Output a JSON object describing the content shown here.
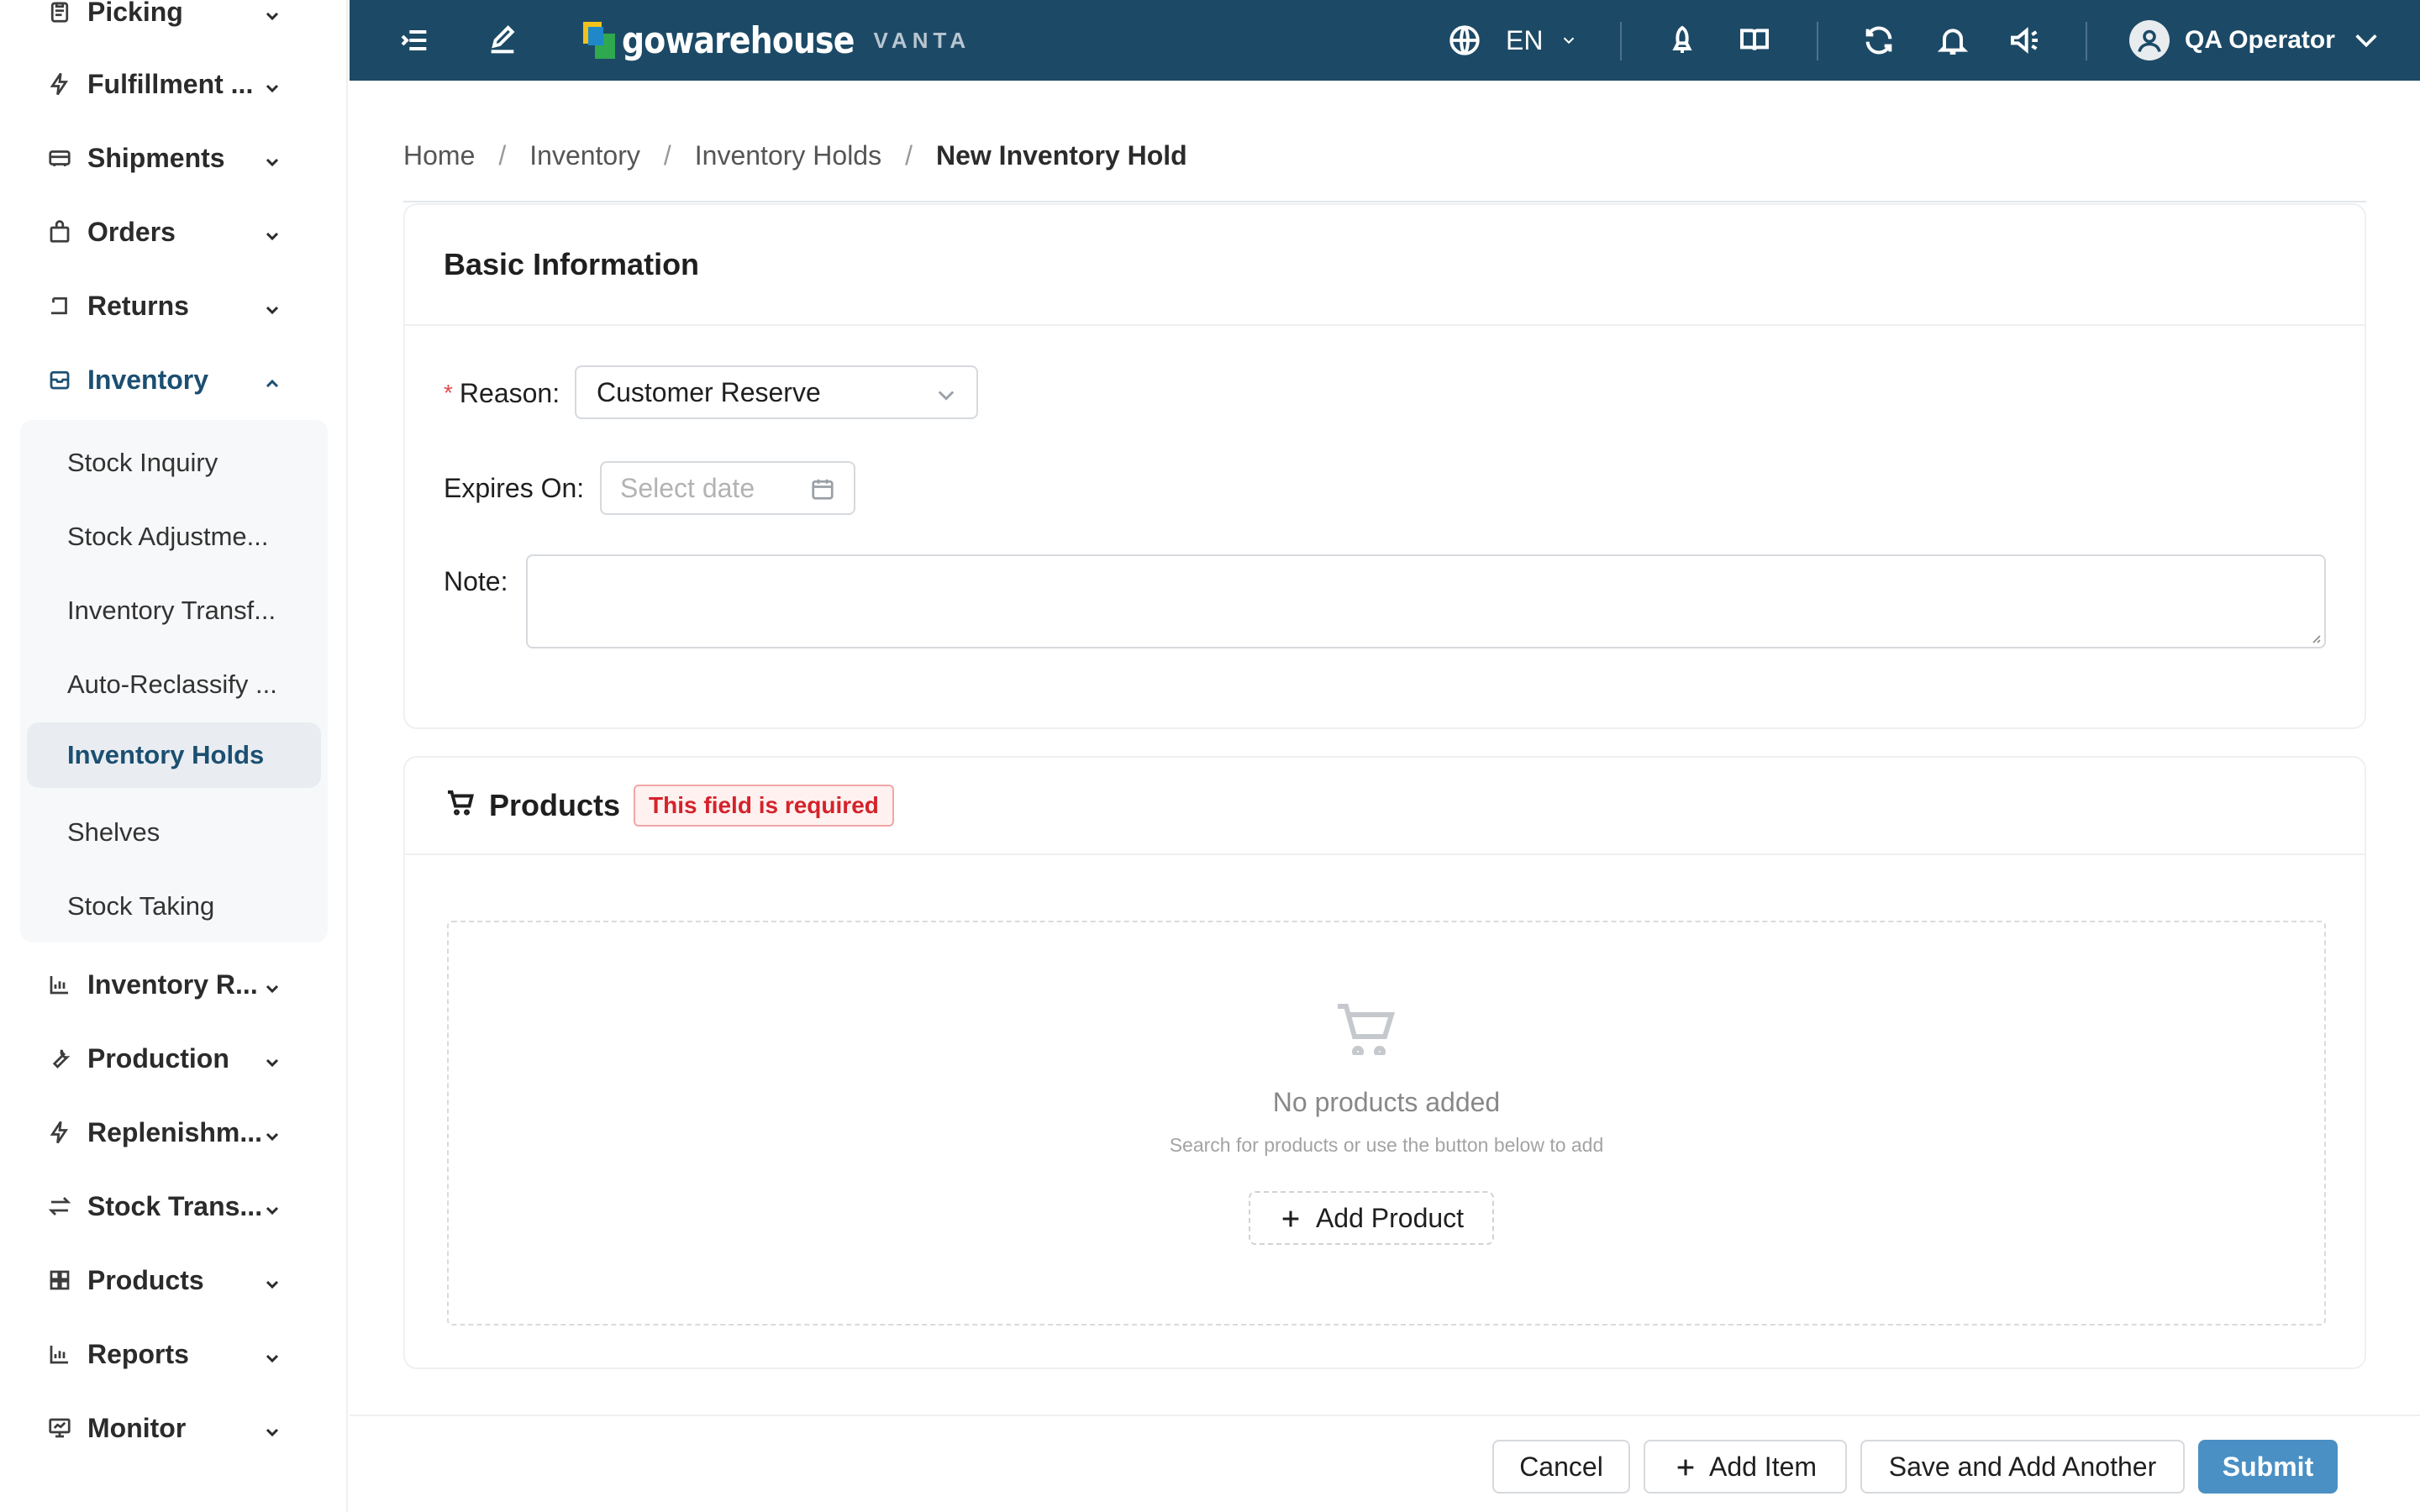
{
  "sidebar": {
    "items": [
      {
        "label": "Picking",
        "icon": "clipboard-icon"
      },
      {
        "label": "Fulfillment ...",
        "icon": "lightning-icon"
      },
      {
        "label": "Shipments",
        "icon": "truck-icon"
      },
      {
        "label": "Orders",
        "icon": "bag-icon"
      },
      {
        "label": "Returns",
        "icon": "return-icon"
      },
      {
        "label": "Inventory",
        "icon": "inbox-icon"
      },
      {
        "label": "Inventory R...",
        "icon": "bar-chart-icon"
      },
      {
        "label": "Production",
        "icon": "wrench-icon"
      },
      {
        "label": "Replenishm...",
        "icon": "lightning-icon"
      },
      {
        "label": "Stock Trans...",
        "icon": "swap-icon"
      },
      {
        "label": "Products",
        "icon": "grid-icon"
      },
      {
        "label": "Reports",
        "icon": "bar-chart-icon"
      },
      {
        "label": "Monitor",
        "icon": "monitor-icon"
      }
    ],
    "sub_items": [
      {
        "label": "Stock Inquiry"
      },
      {
        "label": "Stock Adjustme..."
      },
      {
        "label": "Inventory Transf..."
      },
      {
        "label": "Auto-Reclassify ..."
      },
      {
        "label": "Inventory Holds"
      },
      {
        "label": "Shelves"
      },
      {
        "label": "Stock Taking"
      }
    ],
    "active_item": "Inventory",
    "active_sub_item": "Inventory Holds"
  },
  "topbar": {
    "logo_text": "gowarehouse",
    "logo_sub": "VANTA",
    "language": "EN",
    "user_name": "QA Operator",
    "background_color": "#1c4a66"
  },
  "breadcrumb": {
    "items": [
      "Home",
      "Inventory",
      "Inventory Holds"
    ],
    "current": "New Inventory Hold"
  },
  "basic_info": {
    "title": "Basic Information",
    "reason_label": "Reason",
    "reason_value": "Customer Reserve",
    "expires_label": "Expires On",
    "expires_placeholder": "Select date",
    "note_label": "Note",
    "note_value": ""
  },
  "products": {
    "title": "Products",
    "error_badge": "This field is required",
    "empty_title": "No products added",
    "empty_subtitle": "Search for products or use the button below to add",
    "add_button": "Add Product"
  },
  "footer": {
    "cancel": "Cancel",
    "add_item": "Add Item",
    "save_add_another": "Save and Add Another",
    "submit": "Submit",
    "primary_color": "#4a90c4"
  }
}
